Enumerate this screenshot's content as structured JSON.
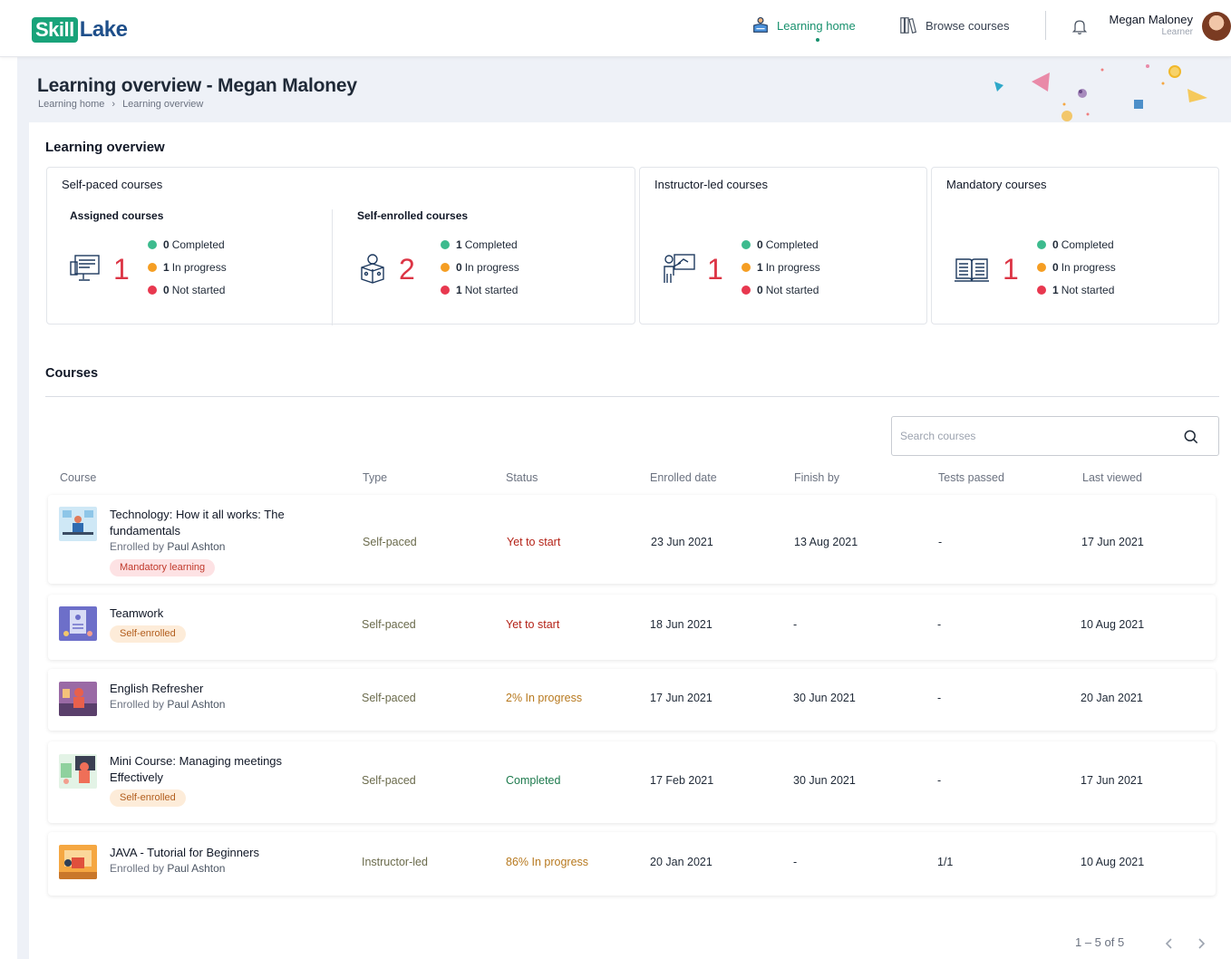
{
  "topbar": {
    "logo_part1": "Skill",
    "logo_part2": "Lake",
    "nav_learning_home": "Learning home",
    "nav_browse_courses": "Browse courses",
    "user_name": "Megan Maloney",
    "user_role": "Learner",
    "icons": [
      "learning-home-icon",
      "browse-courses-icon",
      "bell-icon",
      "avatar"
    ]
  },
  "page": {
    "title": "Learning overview - Megan Maloney",
    "breadcrumb": [
      "Learning home",
      "Learning overview"
    ],
    "breadcrumb_separator": "›"
  },
  "overview": {
    "title": "Learning overview",
    "self_paced": {
      "title": "Self-paced courses",
      "assigned": {
        "title": "Assigned courses",
        "count": "1",
        "completed_num": "0",
        "completed_label": "Completed",
        "in_progress_num": "1",
        "in_progress_label": "In progress",
        "not_started_num": "0",
        "not_started_label": "Not started"
      },
      "self_enrolled": {
        "title": "Self-enrolled courses",
        "count": "2",
        "completed_num": "1",
        "completed_label": "Completed",
        "in_progress_num": "0",
        "in_progress_label": "In progress",
        "not_started_num": "1",
        "not_started_label": "Not started"
      }
    },
    "instructor_led": {
      "title": "Instructor-led courses",
      "count": "1",
      "completed_num": "0",
      "completed_label": "Completed",
      "in_progress_num": "1",
      "in_progress_label": "In progress",
      "not_started_num": "0",
      "not_started_label": "Not started"
    },
    "mandatory": {
      "title": "Mandatory courses",
      "count": "1",
      "completed_num": "0",
      "completed_label": "Completed",
      "in_progress_num": "0",
      "in_progress_label": "In progress",
      "not_started_num": "1",
      "not_started_label": "Not started"
    }
  },
  "courses": {
    "title": "Courses",
    "search_placeholder": "Search courses",
    "columns": [
      "Course",
      "Type",
      "Status",
      "Enrolled date",
      "Finish by",
      "Tests passed",
      "Last viewed"
    ],
    "rows": [
      {
        "title": "Technology: How it all works: The fundamentals",
        "enrolled_by_prefix": "Enrolled by",
        "enrolled_by": "Paul Ashton",
        "tag": "Mandatory learning",
        "type": "Self-paced",
        "status": "Yet to start",
        "enrolled_date": "23 Jun 2021",
        "finish_by": "13 Aug 2021",
        "tests_passed": "-",
        "last_viewed": "17 Jun 2021"
      },
      {
        "title": "Teamwork",
        "tag": "Self-enrolled",
        "type": "Self-paced",
        "status": "Yet to start",
        "enrolled_date": "18 Jun 2021",
        "finish_by": "-",
        "tests_passed": "-",
        "last_viewed": "10 Aug 2021"
      },
      {
        "title": "English Refresher",
        "enrolled_by_prefix": "Enrolled by",
        "enrolled_by": "Paul Ashton",
        "type": "Self-paced",
        "status": "2% In progress",
        "enrolled_date": "17 Jun 2021",
        "finish_by": "30 Jun 2021",
        "tests_passed": "-",
        "last_viewed": "20 Jan 2021"
      },
      {
        "title": "Mini Course: Managing meetings Effectively",
        "tag": "Self-enrolled",
        "type": "Self-paced",
        "status": "Completed",
        "enrolled_date": "17 Feb 2021",
        "finish_by": "30 Jun 2021",
        "tests_passed": "-",
        "last_viewed": "17 Jun 2021"
      },
      {
        "title": "JAVA - Tutorial for Beginners",
        "enrolled_by_prefix": "Enrolled by",
        "enrolled_by": "Paul Ashton",
        "type": "Instructor-led",
        "status": "86% In progress",
        "enrolled_date": "20 Jan 2021",
        "finish_by": "-",
        "tests_passed": "1/1",
        "last_viewed": "10 Aug 2021"
      }
    ],
    "pagination": "1 – 5 of 5"
  },
  "colors": {
    "brand_green": "#19a37a",
    "brand_blue": "#1e4f8a",
    "big_number_red": "#dc3545",
    "completed_dot": "#3dbb8e",
    "in_progress_dot": "#f59e23",
    "not_started_dot": "#e8384f"
  }
}
